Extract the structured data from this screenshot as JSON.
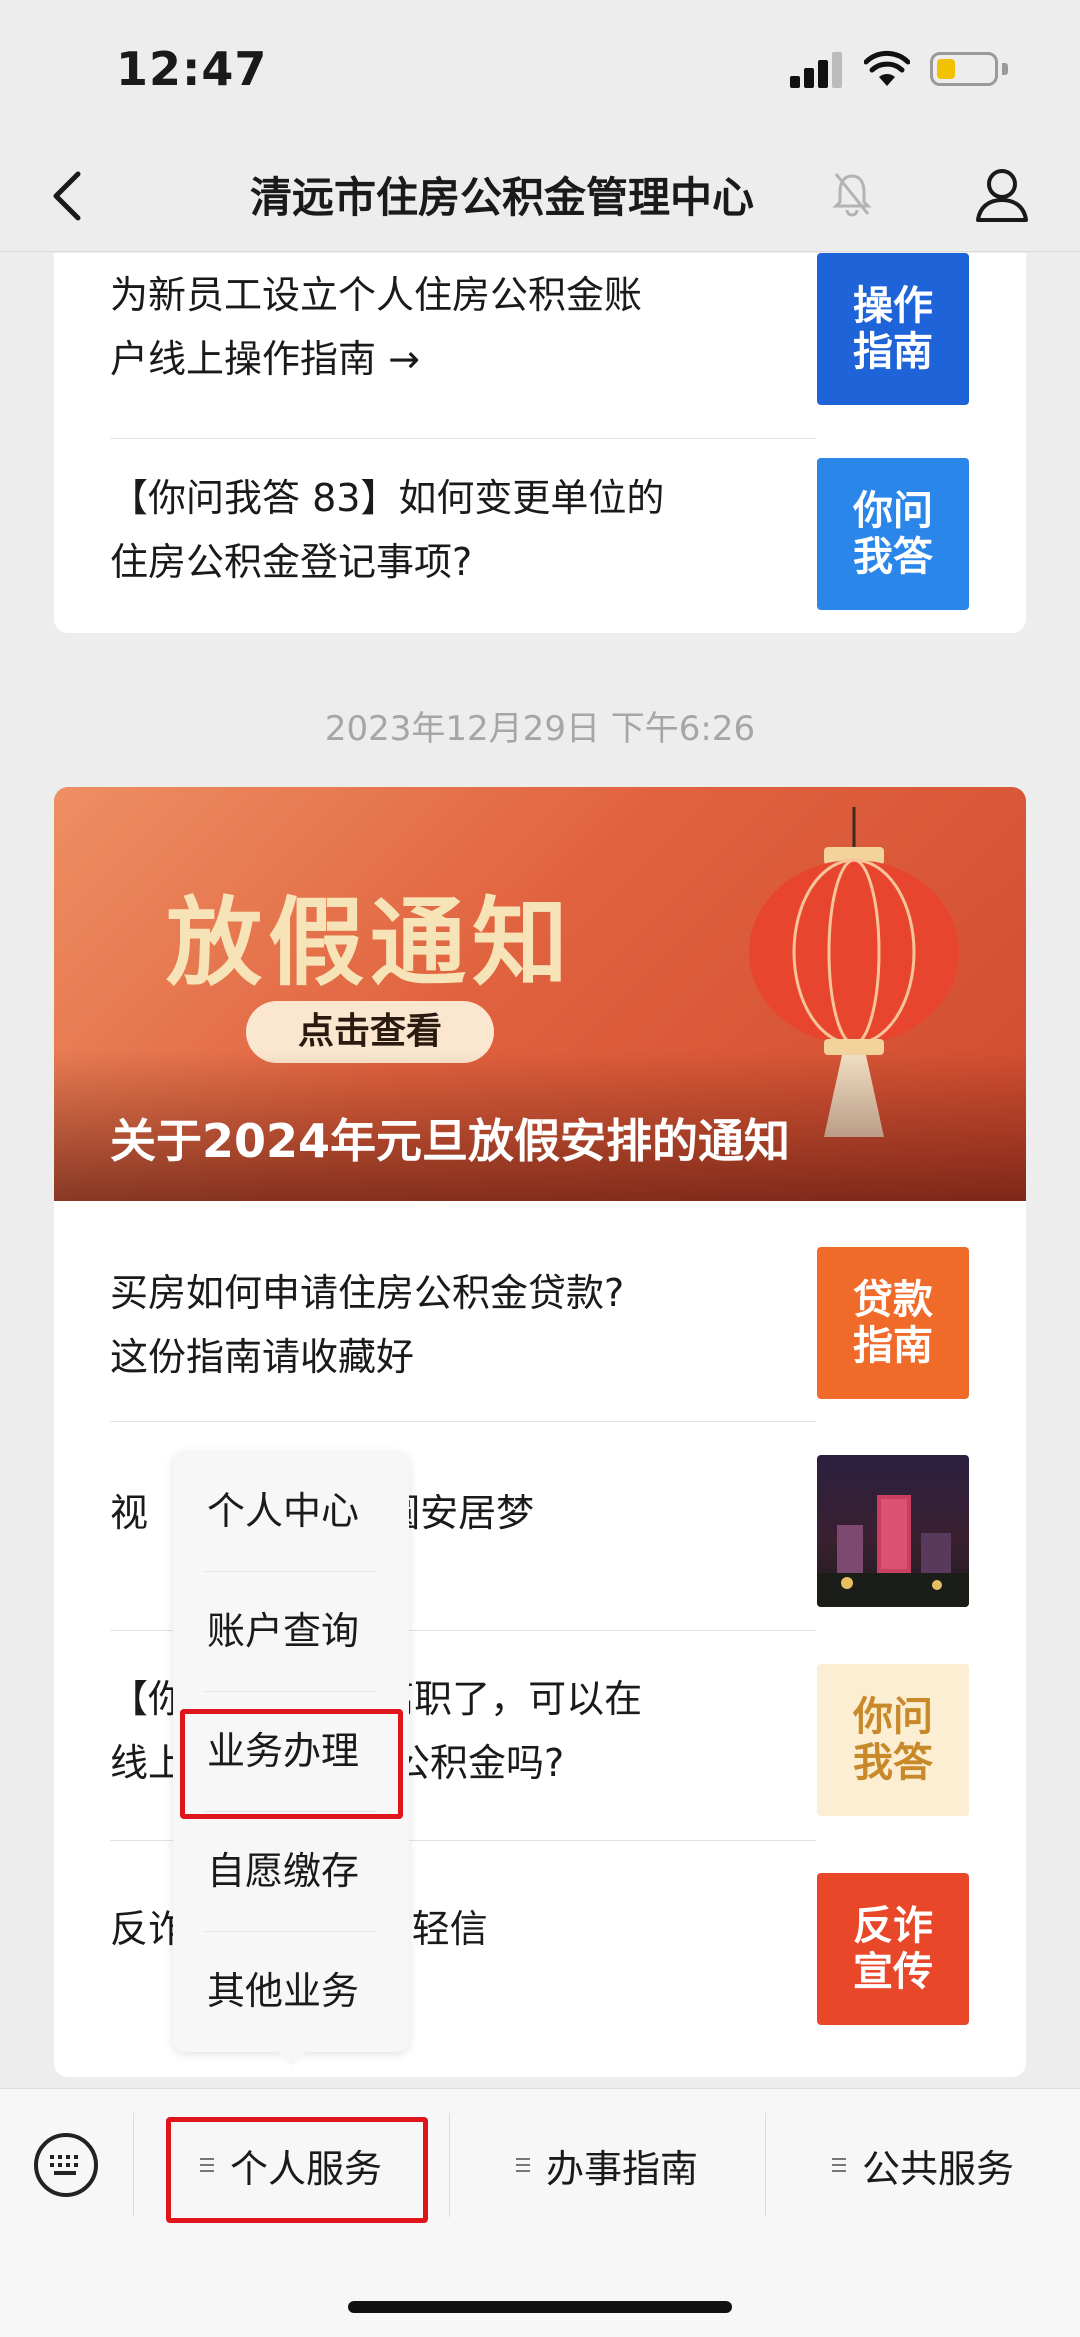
{
  "status": {
    "time": "12:47",
    "battery_level": 0.3,
    "battery_color": "#f2c200"
  },
  "nav": {
    "title": "清远市住房公积金管理中心"
  },
  "articles_top": [
    {
      "title_lines": [
        "为新员工设立个人住房公积金账",
        "户线上操作指南 →"
      ],
      "thumb": [
        "操作",
        "指南"
      ],
      "thumb_bg": "#1e64d8",
      "thumb_fg": "#ffffff"
    },
    {
      "title_lines": [
        "【你问我答 83】如何变更单位的",
        "住房公积金登记事项?"
      ],
      "thumb": [
        "你问",
        "我答"
      ],
      "thumb_bg": "#2a86e8",
      "thumb_fg": "#ffffff"
    }
  ],
  "timestamp": "2023年12月29日 下午6:26",
  "banner": {
    "heading": "放假通知",
    "button": "点击查看",
    "caption": "关于2024年元旦放假安排的通知"
  },
  "articles_bottom": [
    {
      "title_lines": [
        "买房如何申请住房公积金贷款?",
        "这份指南请收藏好"
      ],
      "thumb": [
        "贷款",
        "指南"
      ],
      "thumb_bg": "#f06a2a",
      "thumb_fg": "#ffffff"
    },
    {
      "title_lines": [
        "视频｜住房公积金 圆安居梦"
      ],
      "visible_left": "视",
      "visible_right": "金 圆安居梦",
      "thumb": [
        "",
        ""
      ],
      "thumb_bg": "#2a1a3a",
      "thumb_fg": "#ffffff"
    },
    {
      "title_lines": [
        "【你问我答】离职了，可以在",
        "线上提取住房公积金吗?"
      ],
      "visible_lines": [
        [
          "【你",
          "】 离职了，可以在"
        ],
        [
          "线上",
          "住房公积金吗?"
        ]
      ],
      "thumb": [
        "你问",
        "我答"
      ],
      "thumb_bg": "#fbeed2",
      "thumb_fg": "#c8892a"
    },
    {
      "title_lines": [
        "反诈宣传｜\"秘籍\"别轻信"
      ],
      "visible_left": "反诈",
      "visible_right": "籍”别轻信",
      "thumb": [
        "反诈",
        "宣传"
      ],
      "thumb_bg": "#e8472a",
      "thumb_fg": "#ffffff"
    }
  ],
  "popup_menu": {
    "items": [
      "个人中心",
      "账户查询",
      "业务办理",
      "自愿缴存",
      "其他业务"
    ],
    "highlighted_index": 2
  },
  "tabbar": {
    "tabs": [
      "个人服务",
      "办事指南",
      "公共服务"
    ],
    "highlighted_index": 0
  },
  "colors": {
    "highlight": "#e0141b",
    "banner": "#e0623e"
  }
}
